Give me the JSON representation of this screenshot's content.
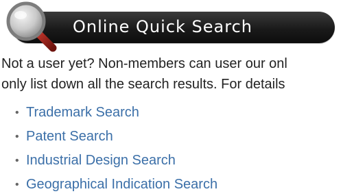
{
  "banner": {
    "title": "Online Quick Search",
    "icon": "magnifier-icon"
  },
  "intro": {
    "line1": "Not a user yet? Non-members can user our onl",
    "line2": "only list down all the search results. For details"
  },
  "links": [
    {
      "label": "Trademark Search"
    },
    {
      "label": "Patent Search"
    },
    {
      "label": "Industrial Design Search"
    },
    {
      "label": "Geographical Indication Search"
    }
  ],
  "colors": {
    "banner_bg": "#1a1a1a",
    "link": "#3b6fa8",
    "text": "#222222"
  }
}
